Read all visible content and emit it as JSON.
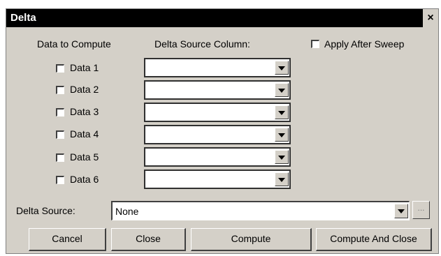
{
  "window": {
    "title": "Delta",
    "close_label": "×"
  },
  "headers": {
    "data_to_compute": "Data to Compute",
    "delta_source_column": "Delta Source Column:"
  },
  "apply_after_sweep": {
    "label": "Apply After Sweep",
    "checked": false
  },
  "rows": [
    {
      "label": "Data 1",
      "checked": false,
      "column": ""
    },
    {
      "label": "Data 2",
      "checked": false,
      "column": ""
    },
    {
      "label": "Data 3",
      "checked": false,
      "column": ""
    },
    {
      "label": "Data 4",
      "checked": false,
      "column": ""
    },
    {
      "label": "Data 5",
      "checked": false,
      "column": ""
    },
    {
      "label": "Data 6",
      "checked": false,
      "column": ""
    }
  ],
  "delta_source": {
    "label": "Delta Source:",
    "value": "None",
    "browse_label": "..."
  },
  "buttons": {
    "cancel": "Cancel",
    "close": "Close",
    "compute": "Compute",
    "compute_and_close": "Compute And Close"
  },
  "colors": {
    "face": "#d4d0c8",
    "titlebar": "#000000"
  }
}
